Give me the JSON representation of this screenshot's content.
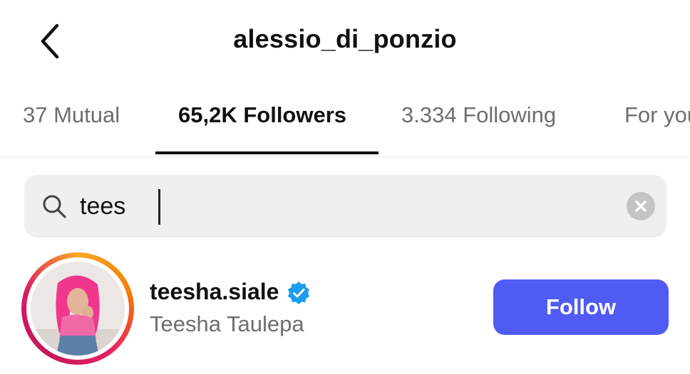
{
  "header": {
    "title": "alessio_di_ponzio",
    "back_icon": "chevron-left-icon"
  },
  "tabs": [
    {
      "label": "37 Mutual",
      "active": false
    },
    {
      "label": "65,2K Followers",
      "active": true
    },
    {
      "label": "3.334 Following",
      "active": false
    },
    {
      "label": "For you",
      "active": false
    }
  ],
  "search": {
    "value": "tees",
    "search_icon": "search-icon",
    "clear_icon": "clear-icon"
  },
  "results": [
    {
      "username": "teesha.siale",
      "verified": true,
      "full_name": "Teesha Taulepa",
      "action_label": "Follow"
    }
  ],
  "colors": {
    "follow_button": "#4f5bf2",
    "verified_badge": "#1d9bf0",
    "story_ring": [
      "#f9a825",
      "#e91e63"
    ]
  }
}
